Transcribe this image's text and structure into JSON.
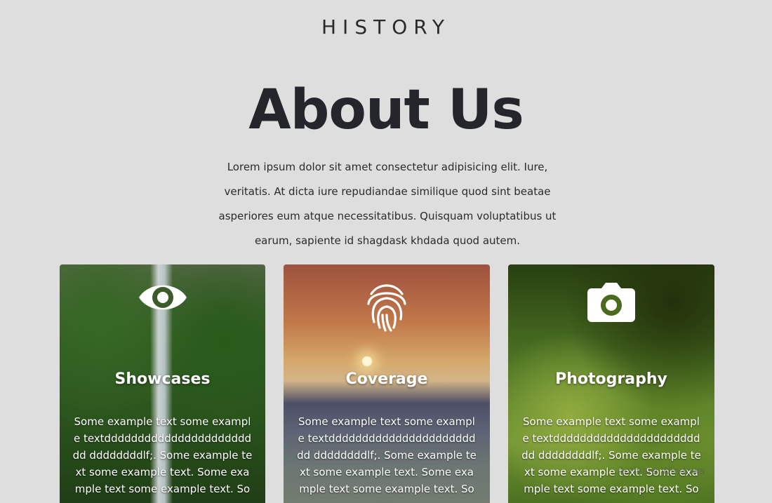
{
  "header": {
    "eyebrow": "HISTORY",
    "title": "About Us"
  },
  "intro": "Lorem ipsum dolor sit amet consectetur adipisicing elit. Iure, veritatis. At dicta iure repudiandae similique quod sint beatae asperiores eum atque necessitatibus. Quisquam voluptatibus ut earum, sapiente id shagdask khdada quod autem.",
  "cards": [
    {
      "icon": "eye-icon",
      "title": "Showcases",
      "text": "Some example text some example textdddddddddddddddddddddddd ddddddddlf;. Some example text some example text. Some example text some example text. Some"
    },
    {
      "icon": "fingerprint-icon",
      "title": "Coverage",
      "text": "Some example text some example textdddddddddddddddddddddddd ddddddddlf;. Some example text some example text. Some example text some example text. Some"
    },
    {
      "icon": "camera-icon",
      "title": "Photography",
      "text": "Some example text some example textdddddddddddddddddddddddd ddddddddlf;. Some example text some example text. Some example text some example text. Some"
    }
  ],
  "watermark": "Activate Windows"
}
